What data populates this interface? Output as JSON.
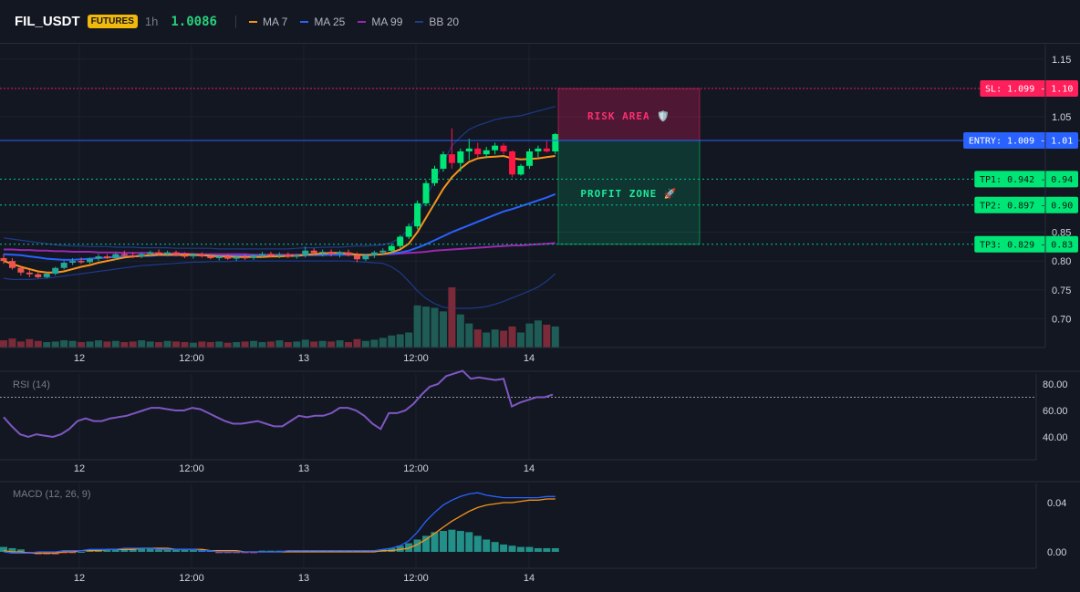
{
  "header": {
    "symbol": "FIL_USDT",
    "badge": "FUTURES",
    "timeframe": "1h",
    "price": "1.0086",
    "legend": [
      {
        "label": "MA 7",
        "color": "#f7931a"
      },
      {
        "label": "MA 25",
        "color": "#2962ff"
      },
      {
        "label": "MA 99",
        "color": "#9c27b0"
      },
      {
        "label": "BB 20",
        "color": "#1e3a8a"
      }
    ]
  },
  "colors": {
    "up": "#26a69a",
    "down": "#ef5350",
    "up_bright": "#00e676",
    "down_bright": "#ff1744",
    "rsi": "#7e57c2",
    "macd": "#2962ff",
    "signal": "#f7931a"
  },
  "price_axis": [
    "1.15",
    "1.05",
    "0.85",
    "0.80",
    "0.75",
    "0.70"
  ],
  "time_axis": [
    "12",
    "12:00",
    "13",
    "12:00",
    "14"
  ],
  "levels": {
    "sl": {
      "label": "SL: 1.099 - 1.10",
      "price": 1.099
    },
    "entry": {
      "label": "ENTRY: 1.009 - 1.01",
      "price": 1.009
    },
    "tp1": {
      "label": "TP1: 0.942 - 0.94",
      "price": 0.942
    },
    "tp2": {
      "label": "TP2: 0.897 - 0.90",
      "price": 0.897
    },
    "tp3": {
      "label": "TP3: 0.829 - 0.83",
      "price": 0.829
    }
  },
  "zones": {
    "risk": "RISK AREA 🛡️",
    "profit": "PROFIT ZONE 🚀"
  },
  "rsi": {
    "title": "RSI (14)",
    "axis": [
      "80.00",
      "60.00",
      "40.00"
    ],
    "reference": 70
  },
  "macd": {
    "title": "MACD (12, 26, 9)",
    "axis": [
      "0.04",
      "0.00"
    ]
  },
  "chart_data": {
    "type": "candlestick",
    "ylim": [
      0.67,
      1.17
    ],
    "candles": [
      [
        0.805,
        0.812,
        0.795,
        0.8
      ],
      [
        0.8,
        0.805,
        0.785,
        0.788
      ],
      [
        0.788,
        0.79,
        0.775,
        0.78
      ],
      [
        0.78,
        0.785,
        0.772,
        0.777
      ],
      [
        0.777,
        0.78,
        0.77,
        0.772
      ],
      [
        0.772,
        0.78,
        0.77,
        0.778
      ],
      [
        0.778,
        0.79,
        0.775,
        0.788
      ],
      [
        0.788,
        0.8,
        0.785,
        0.797
      ],
      [
        0.797,
        0.805,
        0.793,
        0.8
      ],
      [
        0.8,
        0.806,
        0.795,
        0.798
      ],
      [
        0.798,
        0.806,
        0.795,
        0.804
      ],
      [
        0.804,
        0.812,
        0.8,
        0.808
      ],
      [
        0.808,
        0.812,
        0.803,
        0.805
      ],
      [
        0.805,
        0.815,
        0.802,
        0.812
      ],
      [
        0.812,
        0.818,
        0.807,
        0.81
      ],
      [
        0.81,
        0.815,
        0.805,
        0.808
      ],
      [
        0.808,
        0.815,
        0.805,
        0.812
      ],
      [
        0.812,
        0.818,
        0.808,
        0.815
      ],
      [
        0.815,
        0.82,
        0.81,
        0.812
      ],
      [
        0.812,
        0.818,
        0.808,
        0.815
      ],
      [
        0.815,
        0.818,
        0.808,
        0.81
      ],
      [
        0.81,
        0.815,
        0.805,
        0.808
      ],
      [
        0.808,
        0.814,
        0.804,
        0.811
      ],
      [
        0.811,
        0.815,
        0.806,
        0.808
      ],
      [
        0.808,
        0.812,
        0.803,
        0.805
      ],
      [
        0.805,
        0.811,
        0.801,
        0.808
      ],
      [
        0.808,
        0.812,
        0.802,
        0.804
      ],
      [
        0.804,
        0.81,
        0.8,
        0.807
      ],
      [
        0.807,
        0.812,
        0.802,
        0.806
      ],
      [
        0.806,
        0.812,
        0.802,
        0.81
      ],
      [
        0.81,
        0.816,
        0.806,
        0.812
      ],
      [
        0.812,
        0.816,
        0.806,
        0.809
      ],
      [
        0.809,
        0.815,
        0.805,
        0.811
      ],
      [
        0.811,
        0.815,
        0.805,
        0.808
      ],
      [
        0.808,
        0.812,
        0.804,
        0.81
      ],
      [
        0.81,
        0.825,
        0.806,
        0.818
      ],
      [
        0.818,
        0.822,
        0.81,
        0.814
      ],
      [
        0.814,
        0.82,
        0.808,
        0.816
      ],
      [
        0.816,
        0.82,
        0.808,
        0.812
      ],
      [
        0.812,
        0.818,
        0.806,
        0.815
      ],
      [
        0.815,
        0.82,
        0.808,
        0.81
      ],
      [
        0.81,
        0.815,
        0.798,
        0.803
      ],
      [
        0.803,
        0.812,
        0.8,
        0.81
      ],
      [
        0.81,
        0.818,
        0.805,
        0.815
      ],
      [
        0.815,
        0.822,
        0.81,
        0.818
      ],
      [
        0.818,
        0.83,
        0.814,
        0.826
      ],
      [
        0.826,
        0.845,
        0.822,
        0.842
      ],
      [
        0.842,
        0.865,
        0.838,
        0.86
      ],
      [
        0.86,
        0.905,
        0.855,
        0.9
      ],
      [
        0.9,
        0.94,
        0.895,
        0.935
      ],
      [
        0.935,
        0.965,
        0.93,
        0.96
      ],
      [
        0.96,
        0.99,
        0.955,
        0.985
      ],
      [
        0.985,
        1.03,
        0.96,
        0.97
      ],
      [
        0.97,
        0.995,
        0.955,
        0.99
      ],
      [
        0.99,
        1.012,
        0.975,
        0.995
      ],
      [
        0.995,
        1.005,
        0.98,
        0.985
      ],
      [
        0.985,
        0.998,
        0.978,
        0.992
      ],
      [
        0.992,
        1.005,
        0.985,
        1.0
      ],
      [
        1.0,
        1.004,
        0.985,
        0.99
      ],
      [
        0.99,
        0.992,
        0.945,
        0.95
      ],
      [
        0.95,
        0.968,
        0.948,
        0.965
      ],
      [
        0.965,
        0.995,
        0.96,
        0.99
      ],
      [
        0.99,
        1.0,
        0.98,
        0.995
      ],
      [
        0.995,
        1.008,
        0.988,
        0.99
      ],
      [
        0.99,
        1.022,
        0.985,
        1.02
      ]
    ],
    "volumes": [
      0.12,
      0.15,
      0.1,
      0.14,
      0.11,
      0.09,
      0.1,
      0.12,
      0.11,
      0.09,
      0.1,
      0.12,
      0.1,
      0.11,
      0.09,
      0.1,
      0.12,
      0.1,
      0.09,
      0.11,
      0.1,
      0.09,
      0.08,
      0.1,
      0.09,
      0.1,
      0.08,
      0.09,
      0.1,
      0.11,
      0.09,
      0.1,
      0.12,
      0.09,
      0.1,
      0.13,
      0.1,
      0.11,
      0.1,
      0.12,
      0.09,
      0.14,
      0.11,
      0.13,
      0.16,
      0.2,
      0.22,
      0.25,
      0.7,
      0.68,
      0.66,
      0.6,
      1.0,
      0.55,
      0.4,
      0.3,
      0.25,
      0.3,
      0.28,
      0.35,
      0.25,
      0.4,
      0.45,
      0.38,
      0.35
    ],
    "ma7": [
      0.8,
      0.795,
      0.79,
      0.786,
      0.782,
      0.78,
      0.78,
      0.782,
      0.786,
      0.79,
      0.793,
      0.797,
      0.8,
      0.803,
      0.806,
      0.808,
      0.809,
      0.81,
      0.811,
      0.811,
      0.811,
      0.811,
      0.811,
      0.81,
      0.809,
      0.808,
      0.808,
      0.807,
      0.807,
      0.807,
      0.807,
      0.808,
      0.808,
      0.809,
      0.809,
      0.811,
      0.812,
      0.813,
      0.814,
      0.814,
      0.813,
      0.811,
      0.81,
      0.811,
      0.812,
      0.815,
      0.82,
      0.83,
      0.85,
      0.875,
      0.9,
      0.925,
      0.945,
      0.96,
      0.972,
      0.978,
      0.98,
      0.981,
      0.982,
      0.978,
      0.976,
      0.977,
      0.978,
      0.98,
      0.982
    ],
    "ma25": [
      0.812,
      0.811,
      0.81,
      0.808,
      0.806,
      0.804,
      0.803,
      0.802,
      0.802,
      0.803,
      0.804,
      0.805,
      0.806,
      0.807,
      0.808,
      0.808,
      0.809,
      0.809,
      0.81,
      0.81,
      0.81,
      0.81,
      0.81,
      0.81,
      0.81,
      0.809,
      0.809,
      0.809,
      0.809,
      0.809,
      0.809,
      0.809,
      0.809,
      0.809,
      0.809,
      0.81,
      0.81,
      0.81,
      0.811,
      0.811,
      0.811,
      0.811,
      0.811,
      0.811,
      0.812,
      0.813,
      0.815,
      0.818,
      0.823,
      0.829,
      0.836,
      0.843,
      0.85,
      0.856,
      0.862,
      0.868,
      0.874,
      0.88,
      0.886,
      0.89,
      0.895,
      0.9,
      0.905,
      0.91,
      0.916
    ],
    "ma99": [
      0.82,
      0.82,
      0.819,
      0.819,
      0.818,
      0.818,
      0.817,
      0.817,
      0.816,
      0.816,
      0.816,
      0.815,
      0.815,
      0.815,
      0.814,
      0.814,
      0.814,
      0.814,
      0.813,
      0.813,
      0.813,
      0.813,
      0.812,
      0.812,
      0.812,
      0.812,
      0.812,
      0.812,
      0.812,
      0.811,
      0.811,
      0.811,
      0.811,
      0.811,
      0.811,
      0.811,
      0.811,
      0.811,
      0.811,
      0.811,
      0.811,
      0.811,
      0.811,
      0.811,
      0.812,
      0.812,
      0.813,
      0.814,
      0.815,
      0.816,
      0.818,
      0.819,
      0.82,
      0.821,
      0.822,
      0.823,
      0.824,
      0.825,
      0.826,
      0.827,
      0.827,
      0.828,
      0.829,
      0.83,
      0.831
    ],
    "bb_upper": [
      0.84,
      0.838,
      0.836,
      0.834,
      0.832,
      0.83,
      0.828,
      0.827,
      0.826,
      0.826,
      0.825,
      0.825,
      0.825,
      0.824,
      0.824,
      0.824,
      0.823,
      0.823,
      0.823,
      0.823,
      0.822,
      0.822,
      0.822,
      0.822,
      0.822,
      0.821,
      0.821,
      0.821,
      0.821,
      0.821,
      0.821,
      0.821,
      0.821,
      0.821,
      0.822,
      0.823,
      0.823,
      0.824,
      0.824,
      0.824,
      0.825,
      0.826,
      0.826,
      0.827,
      0.828,
      0.832,
      0.84,
      0.855,
      0.88,
      0.91,
      0.94,
      0.97,
      1.0,
      1.015,
      1.028,
      1.035,
      1.04,
      1.045,
      1.048,
      1.05,
      1.052,
      1.056,
      1.06,
      1.064,
      1.068
    ],
    "bb_lower": [
      0.77,
      0.768,
      0.768,
      0.768,
      0.769,
      0.77,
      0.772,
      0.774,
      0.776,
      0.778,
      0.78,
      0.782,
      0.784,
      0.786,
      0.788,
      0.79,
      0.792,
      0.793,
      0.794,
      0.795,
      0.796,
      0.797,
      0.798,
      0.798,
      0.799,
      0.799,
      0.799,
      0.8,
      0.8,
      0.8,
      0.8,
      0.8,
      0.8,
      0.8,
      0.8,
      0.8,
      0.8,
      0.8,
      0.8,
      0.8,
      0.8,
      0.799,
      0.798,
      0.797,
      0.796,
      0.79,
      0.78,
      0.765,
      0.748,
      0.735,
      0.726,
      0.72,
      0.718,
      0.718,
      0.718,
      0.719,
      0.721,
      0.725,
      0.73,
      0.736,
      0.742,
      0.748,
      0.755,
      0.765,
      0.778
    ],
    "rsi_values": [
      55,
      48,
      42,
      40,
      42,
      41,
      40,
      42,
      46,
      52,
      54,
      52,
      52,
      54,
      55,
      56,
      58,
      60,
      62,
      62,
      61,
      60,
      60,
      62,
      61,
      58,
      55,
      52,
      50,
      50,
      51,
      52,
      50,
      48,
      48,
      52,
      56,
      55,
      56,
      56,
      58,
      62,
      62,
      60,
      56,
      50,
      46,
      58,
      58,
      60,
      65,
      72,
      78,
      80,
      86,
      88,
      90,
      84,
      85,
      84,
      83,
      84,
      63,
      66,
      68,
      70,
      70,
      72
    ],
    "macd_line": [
      0.0,
      -0.001,
      -0.001,
      -0.001,
      0.0,
      0.0,
      0.0,
      0.001,
      0.001,
      0.001,
      0.002,
      0.002,
      0.002,
      0.002,
      0.003,
      0.003,
      0.003,
      0.003,
      0.002,
      0.002,
      0.002,
      0.002,
      0.002,
      0.001,
      0.001,
      0.0,
      0.0,
      0.0,
      0.0,
      0.0,
      0.0,
      0.0,
      0.0,
      0.001,
      0.001,
      0.001,
      0.001,
      0.001,
      0.001,
      0.001,
      0.001,
      0.001,
      0.001,
      0.001,
      0.002,
      0.003,
      0.005,
      0.009,
      0.016,
      0.025,
      0.032,
      0.038,
      0.042,
      0.045,
      0.047,
      0.048,
      0.046,
      0.045,
      0.044,
      0.044,
      0.044,
      0.044,
      0.044,
      0.045,
      0.045
    ],
    "signal_line": [
      0.001,
      0.0,
      0.0,
      -0.001,
      -0.001,
      -0.001,
      -0.001,
      0.0,
      0.0,
      0.001,
      0.001,
      0.001,
      0.002,
      0.002,
      0.002,
      0.002,
      0.003,
      0.003,
      0.003,
      0.003,
      0.002,
      0.002,
      0.002,
      0.002,
      0.001,
      0.001,
      0.001,
      0.001,
      0.0,
      0.0,
      0.0,
      0.0,
      0.0,
      0.0,
      0.0,
      0.0,
      0.0,
      0.0,
      0.0,
      0.0,
      0.0,
      0.0,
      0.0,
      0.0,
      0.001,
      0.001,
      0.002,
      0.003,
      0.006,
      0.01,
      0.015,
      0.02,
      0.025,
      0.029,
      0.033,
      0.036,
      0.038,
      0.039,
      0.04,
      0.04,
      0.041,
      0.042,
      0.042,
      0.043,
      0.043
    ],
    "histogram": [
      0.004,
      0.003,
      0.002,
      -0.001,
      -0.002,
      -0.002,
      -0.002,
      -0.001,
      -0.001,
      0.0,
      0.001,
      0.001,
      0.002,
      0.002,
      0.002,
      0.003,
      0.003,
      0.003,
      0.003,
      0.002,
      0.002,
      0.002,
      0.002,
      0.001,
      0.001,
      -0.001,
      -0.001,
      -0.001,
      -0.001,
      -0.001,
      0.001,
      0.001,
      0.001,
      0.001,
      0.001,
      0.001,
      0.001,
      0.001,
      0.001,
      0.001,
      0.001,
      0.001,
      0.001,
      0.001,
      0.002,
      0.003,
      0.005,
      0.007,
      0.01,
      0.013,
      0.016,
      0.017,
      0.018,
      0.017,
      0.016,
      0.013,
      0.01,
      0.008,
      0.006,
      0.005,
      0.004,
      0.004,
      0.003,
      0.003,
      0.003
    ]
  }
}
